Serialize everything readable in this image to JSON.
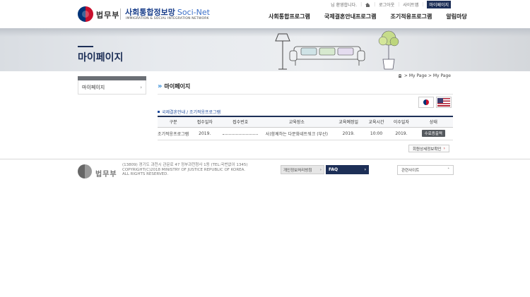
{
  "header": {
    "ministry": "법무부",
    "title_ko": "사회통합정보망",
    "title_en": "Soci-Net",
    "subtitle": "IMMIGRATION & SOCIAL INTEGRATION NETWORK",
    "util": {
      "greeting": "님 환영합니다.",
      "logout": "로그아웃",
      "sitemap": "사이트맵",
      "mypage": "마이페이지"
    },
    "gnb": [
      "사회통합프로그램",
      "국제결혼안내프로그램",
      "조기적응프로그램",
      "알림마당"
    ]
  },
  "banner": {
    "title": "마이페이지"
  },
  "snb": {
    "item": "마이페이지",
    "chevron": "›"
  },
  "breadcrumb": "> My Page > My Page",
  "content": {
    "heading_chevrons": "»",
    "title": "마이페이지",
    "table_caption": "국제결혼안내 / 조기적응프로그램",
    "columns": [
      "구분",
      "접수일자",
      "접수번호",
      "교육장소",
      "교육예정일",
      "교육시간",
      "이수일자",
      "상태"
    ],
    "row": {
      "category": "조기적응프로그램",
      "date": "2019.",
      "receipt_no": "",
      "place": "사)함께하는 다문화네트워크 (부산)",
      "edu_date": "2019.",
      "edu_time": "10:00",
      "done_date": "2019.",
      "status_btn": "수료증출력"
    },
    "member_info_btn": "회원상세정보확인"
  },
  "footer": {
    "ministry": "법무부",
    "address_1": "(13809) 경기도 과천시 관문로 47 정부과천청사 1동 (TEL:국번없이 1345)",
    "address_2": "COPYRIGHT(C)2018 MINISTRY OF JUSTICE REPUBLIC OF KOREA.",
    "address_3": "ALL RIGHTS RESERVED.",
    "privacy": "개인정보처리방침",
    "faq": "FAQ",
    "related": "관련사이트"
  },
  "colors": {
    "navy": "#1d2f57",
    "accent_blue": "#3a8fd8",
    "link_blue": "#1d4a9c"
  },
  "icons": [
    "home-icon",
    "korea-flag-icon",
    "us-flag-icon",
    "chevron-right-icon",
    "chevron-up-icon"
  ]
}
